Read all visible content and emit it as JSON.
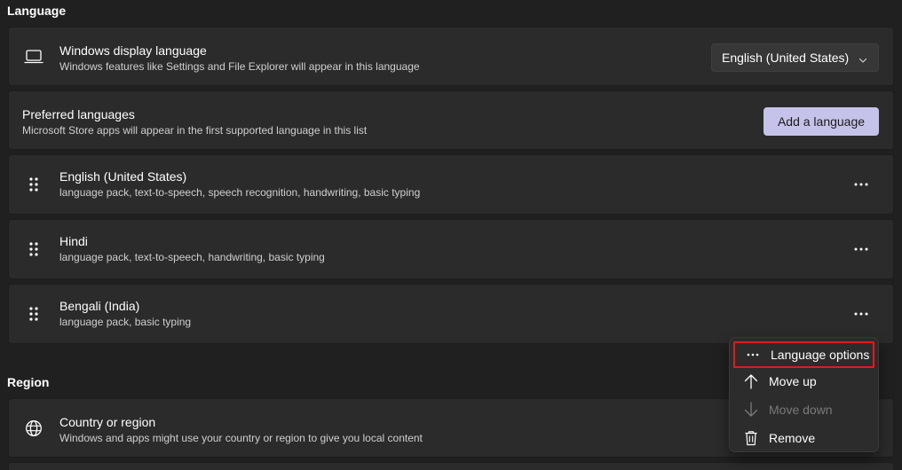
{
  "language_section": {
    "title": "Language",
    "display_language": {
      "title": "Windows display language",
      "desc": "Windows features like Settings and File Explorer will appear in this language",
      "icon": "laptop-icon",
      "selected": "English (United States)"
    },
    "preferred": {
      "title": "Preferred languages",
      "desc": "Microsoft Store apps will appear in the first supported language in this list",
      "button": "Add a language"
    },
    "languages": [
      {
        "name": "English (United States)",
        "features": "language pack, text-to-speech, speech recognition, handwriting, basic typing"
      },
      {
        "name": "Hindi",
        "features": "language pack, text-to-speech, handwriting, basic typing"
      },
      {
        "name": "Bengali (India)",
        "features": "language pack, basic typing"
      }
    ]
  },
  "region_section": {
    "title": "Region",
    "country": {
      "title": "Country or region",
      "desc": "Windows and apps might use your country or region to give you local content",
      "icon": "globe-icon"
    }
  },
  "context_menu": {
    "items": [
      {
        "label": "Language options",
        "icon": "more-horizontal-icon",
        "enabled": true
      },
      {
        "label": "Move up",
        "icon": "arrow-up-icon",
        "enabled": true
      },
      {
        "label": "Move down",
        "icon": "arrow-down-icon",
        "enabled": false
      },
      {
        "label": "Remove",
        "icon": "trash-icon",
        "enabled": true
      }
    ]
  },
  "colors": {
    "background": "#202020",
    "card": "#2b2b2b",
    "accent": "#c6c3ea",
    "highlight": "#e21b1b"
  }
}
